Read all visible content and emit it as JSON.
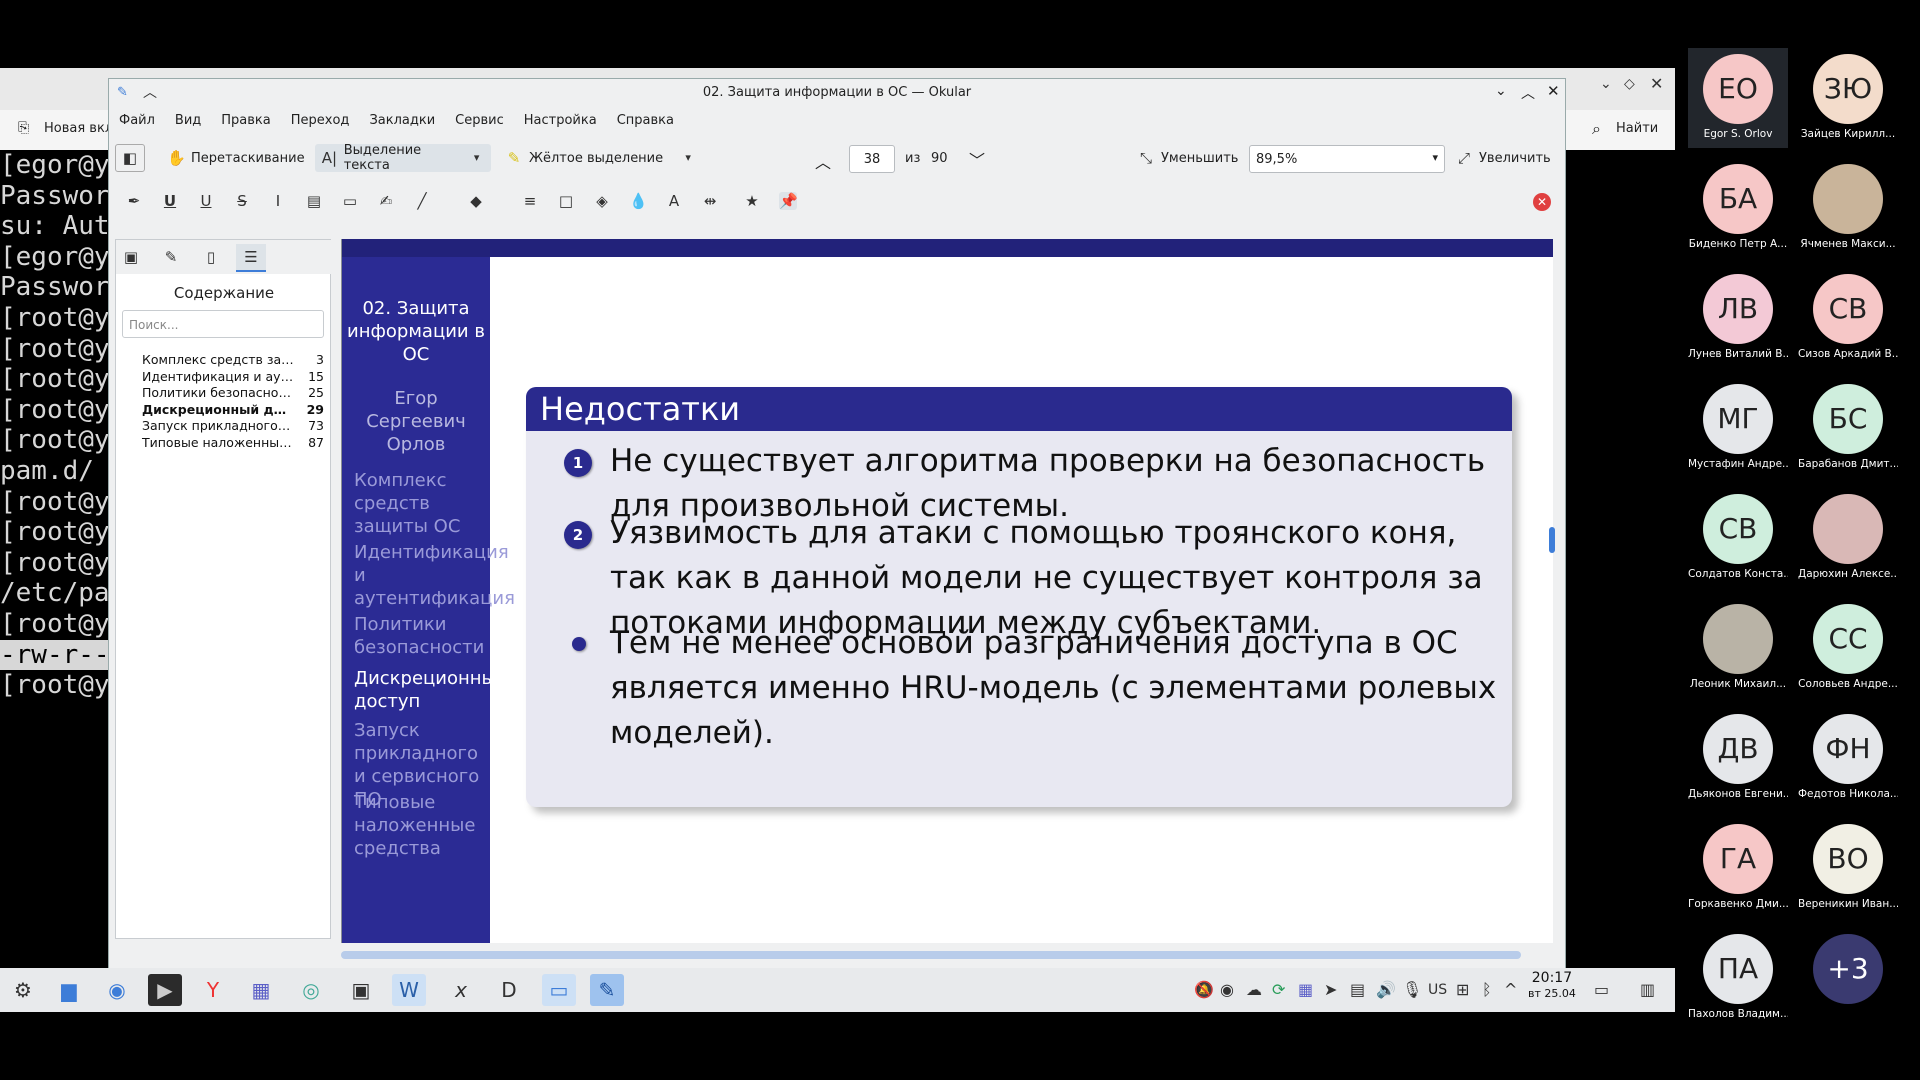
{
  "terminal": {
    "lines": [
      "[egor@y",
      "Passwor",
      "su: Aut",
      "[egor@y",
      "Passwor",
      "[root@y",
      "[root@y",
      "[root@y",
      "[root@y",
      "[root@y",
      "pam.d/",
      "[root@y",
      "[root@y",
      "[root@y",
      "/etc/pa",
      "[root@y",
      "-rw-r--",
      "[root@y"
    ]
  },
  "background_browser": {
    "new_tab": "Новая вкл",
    "find": "Найти"
  },
  "okular": {
    "window_title": "02. Защита информации в ОС — Okular",
    "menu": [
      "Файл",
      "Вид",
      "Правка",
      "Переход",
      "Закладки",
      "Сервис",
      "Настройка",
      "Справка"
    ],
    "toolbar": {
      "browse": "Перетаскивание",
      "text_select": "Выделение текста",
      "highlight": "Жёлтое выделение",
      "page_current": "38",
      "page_of": "из",
      "page_total": "90",
      "zoom_out": "Уменьшить",
      "zoom_value": "89,5%",
      "zoom_in": "Увеличить"
    },
    "sidebar": {
      "title": "Содержание",
      "search_placeholder": "Поиск...",
      "toc": [
        {
          "title": "Комплекс средств защит...",
          "page": "3"
        },
        {
          "title": "Идентификация и аутен...",
          "page": "15"
        },
        {
          "title": "Политики безопасности",
          "page": "25"
        },
        {
          "title": "Дискреционный до...",
          "page": "29"
        },
        {
          "title": "Запуск прикладного и с...",
          "page": "73"
        },
        {
          "title": "Типовые наложенные с...",
          "page": "87"
        }
      ]
    },
    "slide": {
      "nav_title": "02. Защита информации в ОС",
      "nav_author": "Егор Сергеевич Орлов",
      "nav_sections": [
        "Комплекс средств защиты ОС",
        "Идентификация и аутентификация",
        "Политики безопасности",
        "Дискреционный доступ",
        "Запуск прикладного и сервисного ПО",
        "Типовые наложенные средства"
      ],
      "block_title": "Недостатки",
      "items": [
        {
          "marker": "1",
          "text": "Не существует алгоритма проверки на безопасность для произвольной системы."
        },
        {
          "marker": "2",
          "text": "Уязвимость для атаки с помощью троянского коня, так как в данной модели не существует контроля за потоками информации между субъектами."
        },
        {
          "marker": "",
          "text": "Тем не менее основой разграничения доступа в ОС является именно HRU-модель (с элементами ролевых моделей)."
        }
      ]
    }
  },
  "taskbar": {
    "lang": "US",
    "time": "20:17",
    "date": "вт 25.04"
  },
  "participants": [
    {
      "initials": "ЕО",
      "name": "Egor S. Orlov",
      "color": "#f6c7c7"
    },
    {
      "initials": "ЗЮ",
      "name": "Зайцев Кирилл...",
      "color": "#f3dccb"
    },
    {
      "initials": "БА",
      "name": "Биденко Петр А...",
      "color": "#f6c7c7"
    },
    {
      "initials": "",
      "name": "Ячменев Макси...",
      "color": "#c9b49a"
    },
    {
      "initials": "ЛВ",
      "name": "Лунев Виталий В...",
      "color": "#f3c9d6"
    },
    {
      "initials": "СВ",
      "name": "Сизов Аркадий В...",
      "color": "#f6c7c7"
    },
    {
      "initials": "МГ",
      "name": "Мустафин Андре...",
      "color": "#e5e7ea"
    },
    {
      "initials": "БС",
      "name": "Барабанов Дмит...",
      "color": "#cfeedd"
    },
    {
      "initials": "СВ",
      "name": "Солдатов Конста...",
      "color": "#cfeedd"
    },
    {
      "initials": "",
      "name": "Дарюхин Алексе...",
      "color": "#d9b8b6"
    },
    {
      "initials": "",
      "name": "Леоник Михаил...",
      "color": "#b9b3a6"
    },
    {
      "initials": "СС",
      "name": "Соловьев Андре...",
      "color": "#cfeedd"
    },
    {
      "initials": "ДВ",
      "name": "Дьяконов Евгени...",
      "color": "#e5e7ea"
    },
    {
      "initials": "ФН",
      "name": "Федотов Никола...",
      "color": "#e5e7ea"
    },
    {
      "initials": "ГА",
      "name": "Горкавенко Дми...",
      "color": "#f6c7c7"
    },
    {
      "initials": "ВО",
      "name": "Вереникин Иван...",
      "color": "#f1efe4"
    },
    {
      "initials": "ПА",
      "name": "Пахолов Владим...",
      "color": "#e5e7ea"
    },
    {
      "initials": "+3",
      "name": "",
      "color": "#3a3a70"
    }
  ]
}
